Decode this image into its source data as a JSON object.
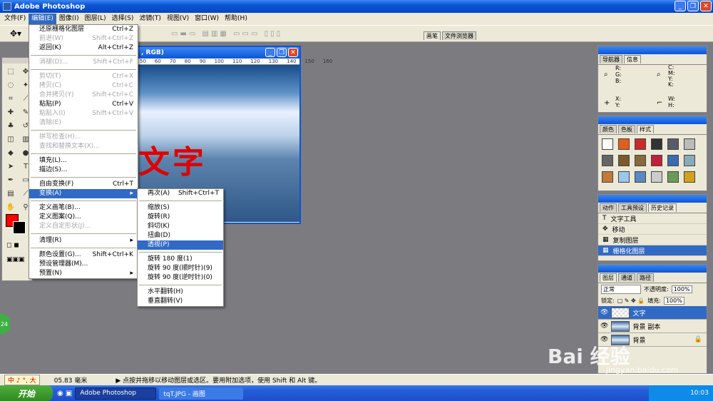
{
  "app": {
    "title": "Adobe Photoshop"
  },
  "menubar": [
    {
      "label": "文件(F)"
    },
    {
      "label": "编辑(E)"
    },
    {
      "label": "图像(I)"
    },
    {
      "label": "图层(L)"
    },
    {
      "label": "选择(S)"
    },
    {
      "label": "滤镜(T)"
    },
    {
      "label": "视图(V)"
    },
    {
      "label": "窗口(W)"
    },
    {
      "label": "帮助(H)"
    }
  ],
  "optbar": {
    "tabs": [
      "画笔",
      "文件浏览器"
    ]
  },
  "document": {
    "title": ", RGB)",
    "ruler": [
      "50",
      "60",
      "70",
      "80",
      "90",
      "100",
      "110",
      "120",
      "130",
      "140",
      "150",
      "160"
    ],
    "canvas_text": "文字"
  },
  "edit_menu": [
    {
      "label": "还原栅格化图层",
      "shortcut": "Ctrl+Z",
      "enabled": true
    },
    {
      "label": "前进(W)",
      "shortcut": "Shift+Ctrl+Z",
      "enabled": false
    },
    {
      "label": "返回(K)",
      "shortcut": "Alt+Ctrl+Z",
      "enabled": true
    },
    {
      "sep": true
    },
    {
      "label": "消褪(D)...",
      "shortcut": "Shift+Ctrl+F",
      "enabled": false
    },
    {
      "sep": true
    },
    {
      "label": "剪切(T)",
      "shortcut": "Ctrl+X",
      "enabled": false
    },
    {
      "label": "拷贝(C)",
      "shortcut": "Ctrl+C",
      "enabled": false
    },
    {
      "label": "合并拷贝(Y)",
      "shortcut": "Shift+Ctrl+C",
      "enabled": false
    },
    {
      "label": "粘贴(P)",
      "shortcut": "Ctrl+V",
      "enabled": true
    },
    {
      "label": "粘贴入(I)",
      "shortcut": "Shift+Ctrl+V",
      "enabled": false
    },
    {
      "label": "清除(E)",
      "shortcut": "",
      "enabled": false
    },
    {
      "sep": true
    },
    {
      "label": "拼写检查(H)...",
      "shortcut": "",
      "enabled": false
    },
    {
      "label": "查找和替换文本(X)...",
      "shortcut": "",
      "enabled": false
    },
    {
      "sep": true
    },
    {
      "label": "填充(L)...",
      "shortcut": "",
      "enabled": true
    },
    {
      "label": "描边(S)...",
      "shortcut": "",
      "enabled": true
    },
    {
      "sep": true
    },
    {
      "label": "自由变换(F)",
      "shortcut": "Ctrl+T",
      "enabled": true
    },
    {
      "label": "变换(A)",
      "shortcut": "▸",
      "enabled": true,
      "highlight": true
    },
    {
      "sep": true
    },
    {
      "label": "定义画笔(B)...",
      "shortcut": "",
      "enabled": true
    },
    {
      "label": "定义图案(Q)...",
      "shortcut": "",
      "enabled": true
    },
    {
      "label": "定义自定形状(J)...",
      "shortcut": "",
      "enabled": false
    },
    {
      "sep": true
    },
    {
      "label": "清理(R)",
      "shortcut": "▸",
      "enabled": true
    },
    {
      "sep": true
    },
    {
      "label": "颜色设置(G)...",
      "shortcut": "Shift+Ctrl+K",
      "enabled": true
    },
    {
      "label": "预设管理器(M)...",
      "shortcut": "",
      "enabled": true
    },
    {
      "label": "预置(N)",
      "shortcut": "▸",
      "enabled": true
    }
  ],
  "transform_menu": [
    {
      "label": "再次(A)",
      "shortcut": "Shift+Ctrl+T"
    },
    {
      "sep": true
    },
    {
      "label": "缩放(S)",
      "shortcut": ""
    },
    {
      "label": "旋转(R)",
      "shortcut": ""
    },
    {
      "label": "斜切(K)",
      "shortcut": ""
    },
    {
      "label": "扭曲(D)",
      "shortcut": ""
    },
    {
      "label": "透视(P)",
      "shortcut": "",
      "highlight": true
    },
    {
      "sep": true
    },
    {
      "label": "旋转 180 度(1)",
      "shortcut": ""
    },
    {
      "label": "旋转 90 度(顺时针)(9)",
      "shortcut": ""
    },
    {
      "label": "旋转 90 度(逆时针)(0)",
      "shortcut": ""
    },
    {
      "sep": true
    },
    {
      "label": "水平翻转(H)",
      "shortcut": ""
    },
    {
      "label": "垂直翻转(V)",
      "shortcut": ""
    }
  ],
  "info_panel": {
    "tabs": [
      "导航器",
      "信息"
    ],
    "rgb": "R:\nG:\nB:",
    "cmyk": "C:\nM:\nY:\nK:",
    "xy": "X:\nY:",
    "wh": "W:\nH:"
  },
  "swatch_panel": {
    "tabs": [
      "颜色",
      "色板",
      "样式"
    ]
  },
  "history_panel": {
    "tabs": [
      "动作",
      "工具预设",
      "历史记录"
    ],
    "items": [
      {
        "label": "文字工具",
        "icon": "T"
      },
      {
        "label": "移动",
        "icon": "✥"
      },
      {
        "label": "复制图层",
        "icon": "▦"
      },
      {
        "label": "栅格化图层",
        "icon": "▦",
        "highlight": true
      }
    ]
  },
  "layers_panel": {
    "tabs": [
      "图层",
      "通道",
      "路径"
    ],
    "mode": "正常",
    "opacity_label": "不透明度:",
    "opacity": "100%",
    "lock_label": "锁定:",
    "fill_label": "填充:",
    "fill": "100%",
    "layers": [
      {
        "name": "文字",
        "highlight": true
      },
      {
        "name": "背景 副本",
        "highlight": false
      },
      {
        "name": "背景",
        "highlight": false
      }
    ]
  },
  "statusbar": {
    "ime": "中 ♪ °, 大",
    "measure": "05.83 毫米",
    "message": "▶ 点按并拖移以移动图层或选区。要用附加选项，使用 Shift 和 Alt 键。"
  },
  "taskbar": {
    "start": "开始",
    "tasks": [
      "Adobe Photoshop",
      "tqT.JPG - 画图"
    ],
    "clock": "10:03"
  },
  "watermark": {
    "brand": "Bai 经验",
    "url": "jingyan.baidu.com"
  },
  "side_badge": "24"
}
